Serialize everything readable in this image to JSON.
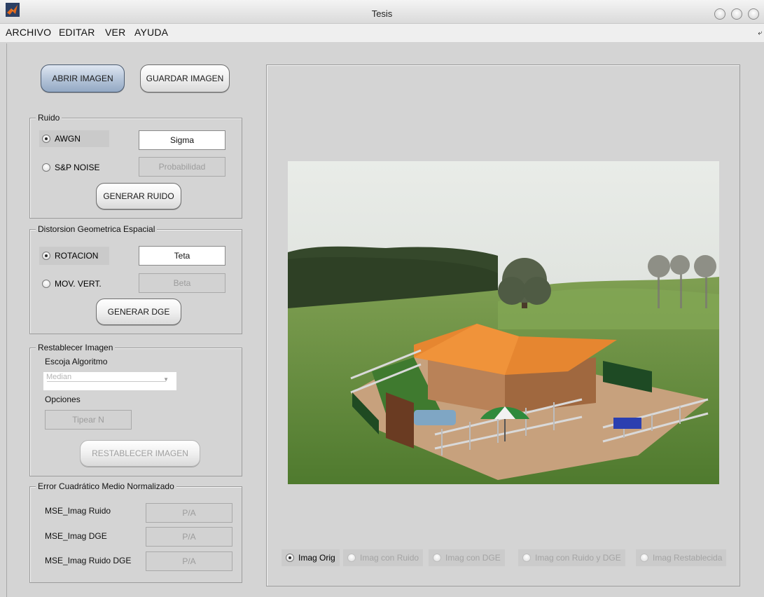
{
  "window": {
    "title": "Tesis"
  },
  "menu": [
    "ARCHIVO",
    "EDITAR",
    "VER",
    "AYUDA"
  ],
  "buttons": {
    "open_image": "ABRIR IMAGEN",
    "save_image": "GUARDAR IMAGEN",
    "generate_noise": "GENERAR RUIDO",
    "generate_dge": "GENERAR DGE",
    "restore_image": "RESTABLECER IMAGEN"
  },
  "noise": {
    "title": "Ruido",
    "options": [
      {
        "label": "AWGN",
        "selected": true
      },
      {
        "label": "S&P NOISE",
        "selected": false
      }
    ],
    "sigma_field": "Sigma",
    "prob_field": "Probabilidad"
  },
  "distortion": {
    "title": "Distorsion Geometrica Espacial",
    "options": [
      {
        "label": "ROTACION",
        "selected": true
      },
      {
        "label": "MOV. VERT.",
        "selected": false
      }
    ],
    "teta_field": "Teta",
    "beta_field": "Beta"
  },
  "restore": {
    "title": "Restablecer Imagen",
    "algorithm_label": "Escoja Algoritmo",
    "algorithm_value": "Median",
    "options_label": "Opciones",
    "n_field": "Tipear N"
  },
  "mse": {
    "title": "Error Cuadrático Medio Normalizado",
    "rows": [
      {
        "label": "MSE_Imag Ruido",
        "value": "P/A"
      },
      {
        "label": "MSE_Imag DGE",
        "value": "P/A"
      },
      {
        "label": "MSE_Imag Ruido DGE",
        "value": "P/A"
      }
    ]
  },
  "view_options": [
    {
      "label": "Imag Orig",
      "selected": true,
      "enabled": true
    },
    {
      "label": "Imag con Ruido",
      "selected": false,
      "enabled": false
    },
    {
      "label": "Imag con DGE",
      "selected": false,
      "enabled": false
    },
    {
      "label": "Imag con Ruido y DGE",
      "selected": false,
      "enabled": false
    },
    {
      "label": "Imag Restablecida",
      "selected": false,
      "enabled": false
    }
  ],
  "colors": {
    "panel_bg": "#d4d4d4",
    "primary_button": "#b7c6da",
    "disabled_text": "#a4a4a4"
  }
}
